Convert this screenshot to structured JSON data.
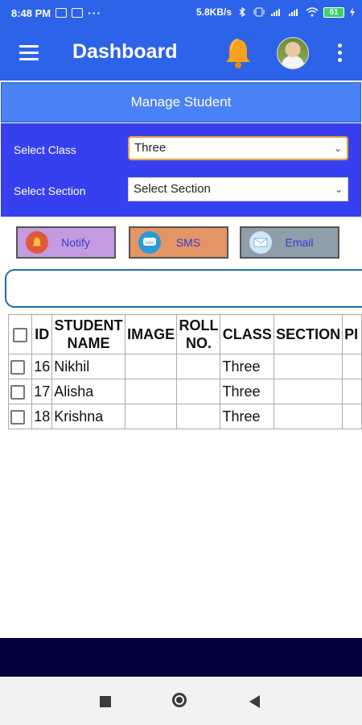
{
  "status_bar": {
    "time": "8:48 PM",
    "more": "···",
    "net_speed": "5.8KB/s",
    "battery": "61"
  },
  "app_bar": {
    "title": "Dashboard",
    "color": "#2d63e8"
  },
  "manage": {
    "title": "Manage Student"
  },
  "filters": {
    "class_label": "Select Class",
    "class_value": "Three",
    "section_label": "Select Section",
    "section_value": "Select Section"
  },
  "actions": {
    "notify": "Notify",
    "sms": "SMS",
    "email": "Email"
  },
  "search": {
    "placeholder": ""
  },
  "table": {
    "headers": {
      "id": "ID",
      "student_name_1": "STUDENT",
      "student_name_2": "NAME",
      "image": "IMAGE",
      "roll_1": "ROLL",
      "roll_2": "NO.",
      "class": "CLASS",
      "section": "SECTION",
      "more": "PI"
    },
    "rows": [
      {
        "id": "16",
        "name": "Nikhil",
        "image": "",
        "roll": "",
        "class": "Three",
        "section": ""
      },
      {
        "id": "17",
        "name": "Alisha",
        "image": "",
        "roll": "",
        "class": "Three",
        "section": ""
      },
      {
        "id": "18",
        "name": "Krishna",
        "image": "",
        "roll": "",
        "class": "Three",
        "section": ""
      }
    ]
  }
}
